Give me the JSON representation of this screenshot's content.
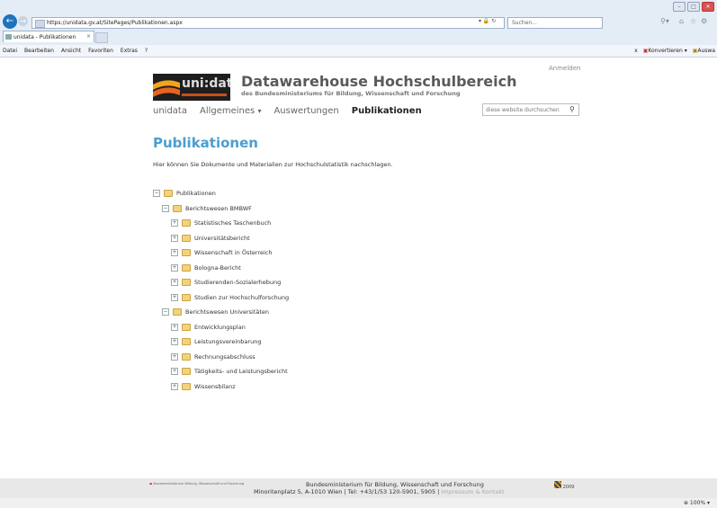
{
  "browser": {
    "url": "https://unidata.gv.at/SitePages/Publikationen.aspx",
    "search_placeholder": "Suchen...",
    "tab_title": "unidata - Publikationen",
    "tab_close": "×",
    "menu": [
      "Datei",
      "Bearbeiten",
      "Ansicht",
      "Favoriten",
      "Extras",
      "?"
    ],
    "toolbar": {
      "close_x": "x",
      "konvertieren": "Konvertieren",
      "auswahl": "Auswa"
    },
    "zoom": "100%"
  },
  "header": {
    "login": "Anmelden",
    "logo_text": "uni:data",
    "title": "Datawarehouse Hochschulbereich",
    "subtitle": "des Bundesministeriums für Bildung, Wissenschaft und Forschung",
    "site_search_placeholder": "diese website durchsuchen"
  },
  "nav": {
    "items": [
      {
        "label": "unidata"
      },
      {
        "label": "Allgemeines"
      },
      {
        "label": "Auswertungen"
      },
      {
        "label": "Publikationen"
      }
    ],
    "dropdown_glyph": "▾"
  },
  "main": {
    "heading": "Publikationen",
    "intro": "Hier können Sie Dokumente und Materialien zur Hochschulstatistik nachschlagen.",
    "tree": [
      {
        "label": "Publikationen",
        "level": 0,
        "expanded": true
      },
      {
        "label": "Berichtswesen BMBWF",
        "level": 1,
        "expanded": true
      },
      {
        "label": "Statistisches Taschenbuch",
        "level": 2,
        "expanded": false
      },
      {
        "label": "Universitätsbericht",
        "level": 2,
        "expanded": false
      },
      {
        "label": "Wissenschaft in Österreich",
        "level": 2,
        "expanded": false
      },
      {
        "label": "Bologna-Bericht",
        "level": 2,
        "expanded": false
      },
      {
        "label": "Studierenden-Sozialerhebung",
        "level": 2,
        "expanded": false
      },
      {
        "label": "Studien zur Hochschulforschung",
        "level": 2,
        "expanded": false
      },
      {
        "label": "Berichtswesen Universitäten",
        "level": 1,
        "expanded": true
      },
      {
        "label": "Entwicklungsplan",
        "level": 2,
        "expanded": false
      },
      {
        "label": "Leistungsvereinbarung",
        "level": 2,
        "expanded": false
      },
      {
        "label": "Rechnungsabschluss",
        "level": 2,
        "expanded": false
      },
      {
        "label": "Tätigkeits- und Leistungsbericht",
        "level": 2,
        "expanded": false
      },
      {
        "label": "Wissensbilanz",
        "level": 2,
        "expanded": false
      }
    ]
  },
  "footer": {
    "ministry_logo": "Bundesministerium Bildung, Wissenschaft und Forschung",
    "line1": "Bundesministerium für Bildung, Wissenschaft und Forschung",
    "line2": "Minoritenplatz 5, A-1010 Wien | Tel: +43/1/53 120-5901, 5905 | ",
    "link": "Impressum & Kontakt",
    "badge": "2009"
  },
  "colors": {
    "accent": "#4a9ed0",
    "chrome": "#e4ecf6"
  }
}
